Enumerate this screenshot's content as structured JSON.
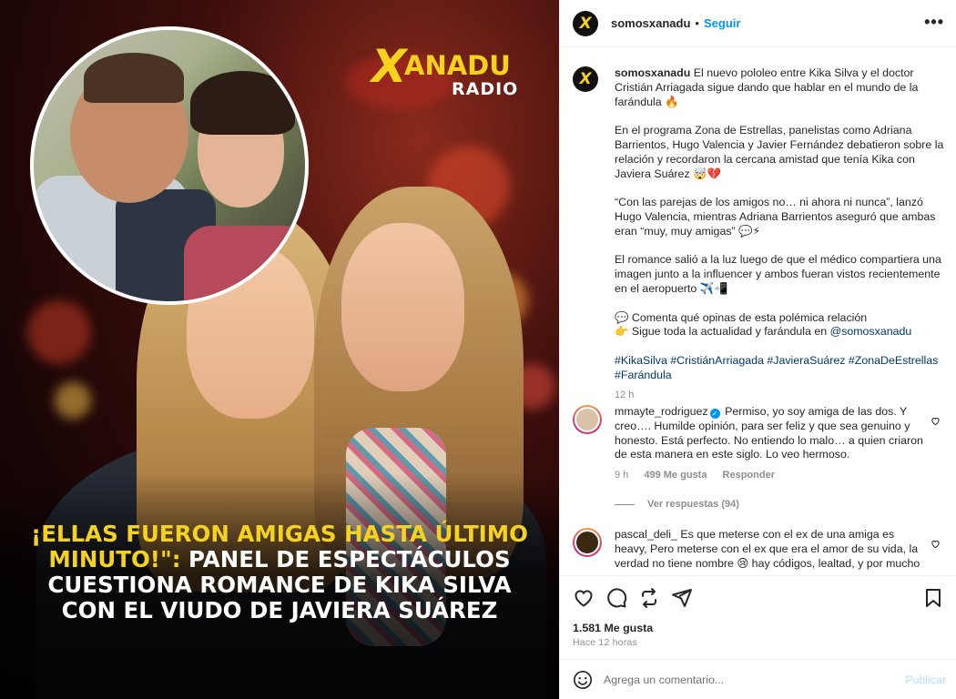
{
  "media": {
    "logo_mark": "X",
    "logo_word": "ANADU",
    "logo_sub": "RADIO",
    "headline_yellow": "¡ELLAS FUERON AMIGAS HASTA ÚLTIMO MINUTO!\":",
    "headline_white": " PANEL DE ESPECTÁCULOS CUESTIONA ROMANCE DE KIKA SILVA CON EL VIUDO DE JAVIERA SUÁREZ"
  },
  "header": {
    "username": "somosxanadu",
    "dot": "•",
    "follow_label": "Seguir",
    "more_label": "•••",
    "avatar_letter": "X"
  },
  "caption": {
    "username": "somosxanadu",
    "p1": "El nuevo pololeo entre Kika Silva y el doctor Cristián Arriagada sigue dando que hablar en el mundo de la farándula 🔥",
    "p2": "En el programa Zona de Estrellas, panelistas como Adriana Barrientos, Hugo Valencia y Javier Fernández debatieron sobre la relación y recordaron la cercana amistad que tenía Kika con Javiera Suárez 🤯💔",
    "p3": "“Con las parejas de los amigos no… ni ahora ni nunca”, lanzó Hugo Valencia, mientras Adriana Barrientos aseguró que ambas eran “muy, muy amigas” 💬⚡",
    "p4": "El romance salió a la luz luego de que el médico compartiera una imagen junto a la influencer y ambos fueran vistos recientemente en el aeropuerto ✈️📲",
    "p5a": "💬 Comenta qué opinas de esta polémica relación",
    "p5b": "👉 Sigue toda la actualidad y farándula en ",
    "mention": "@somosxanadu",
    "hashtags": "#KikaSilva #CristiánArriagada #JavieraSuárez #ZonaDeEstrellas #Farándula",
    "time": "12 h"
  },
  "comments": [
    {
      "user": "mmayte_rodriguez",
      "verified_mark": "✓",
      "text": "Permiso, yo soy amiga de las dos. Y creo…. Humilde opinión, para ser feliz y que sea genuino y honesto. Está perfecto. No entiendo lo malo… a quien criaron de esta manera en este siglo. Lo veo hermoso.",
      "time": "9 h",
      "likes": "499 Me gusta",
      "reply": "Responder",
      "avatar_color": "#d9c2a8"
    },
    {
      "user": "pascal_deli_",
      "text": "Es que meterse con el ex de una amiga es heavy, Pero meterse con el ex que era el amor de su vida, la verdad no tiene nombre 😢 hay códigos, lealtad, y por mucho",
      "avatar_color": "#3a2a12"
    }
  ],
  "view_replies": "Ver respuestas (94)",
  "actions": {
    "likes": "1.581 Me gusta",
    "ago": "Hace 12 horas"
  },
  "add_comment": {
    "placeholder": "Agrega un comentario...",
    "publish": "Publicar"
  }
}
